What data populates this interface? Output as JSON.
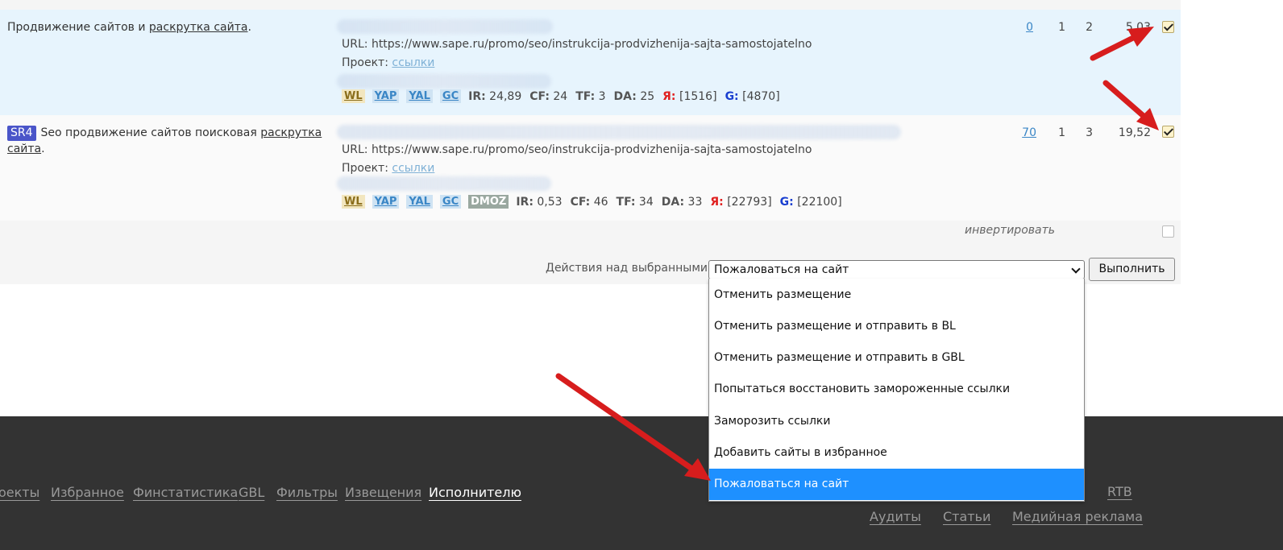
{
  "rows": [
    {
      "title_prefix": "Продвижение сайтов и ",
      "title_link": "раскрутка сайта",
      "title_suffix": ".",
      "badge": "",
      "url": "URL: https://www.sape.ru/promo/seo/instrukcija-prodvizhenija-sajta-samostojatelno",
      "project_label": "Проект: ",
      "project_link": "ссылки",
      "tags": [
        "WL",
        "YAP",
        "YAL",
        "GC"
      ],
      "ir": "24,89",
      "cf": "24",
      "tf": "3",
      "da": "25",
      "ya": "[1516]",
      "g": "[4870]",
      "col1": "0",
      "col2": "1",
      "col3": "2",
      "price": "5,03",
      "checked": true
    },
    {
      "title_prefix": "Seo продвижение сайтов поисковая ",
      "title_link1": "раскрутка",
      "title_link2": "сайта",
      "title_suffix": ".",
      "badge": "SR4",
      "url": "URL: https://www.sape.ru/promo/seo/instrukcija-prodvizhenija-sajta-samostojatelno",
      "project_label": "Проект: ",
      "project_link": "ссылки",
      "tags": [
        "WL",
        "YAP",
        "YAL",
        "GC",
        "DMOZ"
      ],
      "ir": "0,53",
      "cf": "46",
      "tf": "34",
      "da": "33",
      "ya": "[22793]",
      "g": "[22100]",
      "col1": "70",
      "col2": "1",
      "col3": "3",
      "price": "19,52",
      "checked": true
    }
  ],
  "metric_labels": {
    "ir": "IR:",
    "cf": "CF:",
    "tf": "TF:",
    "da": "DA:",
    "ya": "Я:",
    "g": "G:"
  },
  "invert_label": "инвертировать",
  "actions": {
    "label": "Действия над выбранными:",
    "selected": "Пожаловаться на сайт",
    "execute_label": "Выполнить",
    "options": [
      "Отменить размещение",
      "Отменить размещение и отправить в BL",
      "Отменить размещение и отправить в GBL",
      "Попытаться восстановить замороженные ссылки",
      "Заморозить ссылки",
      "Добавить сайты в избранное",
      "Пожаловаться на сайт"
    ]
  },
  "footer": {
    "nav": [
      "оекты",
      "Избранное",
      "Финстатистика",
      "GBL",
      "Фильтры",
      "Извещения",
      "Исполнителю"
    ],
    "active": "Исполнителю",
    "right_top": "RTB",
    "right_bottom": [
      "Аудиты",
      "Статьи",
      "Медийная реклама"
    ]
  },
  "colors": {
    "row_highlight": "#e7f4fd",
    "footer_bg": "#333333",
    "dropdown_selected": "#1e90ff",
    "annotation_arrow": "#d71d1d",
    "sr_badge": "#4a55c9"
  }
}
